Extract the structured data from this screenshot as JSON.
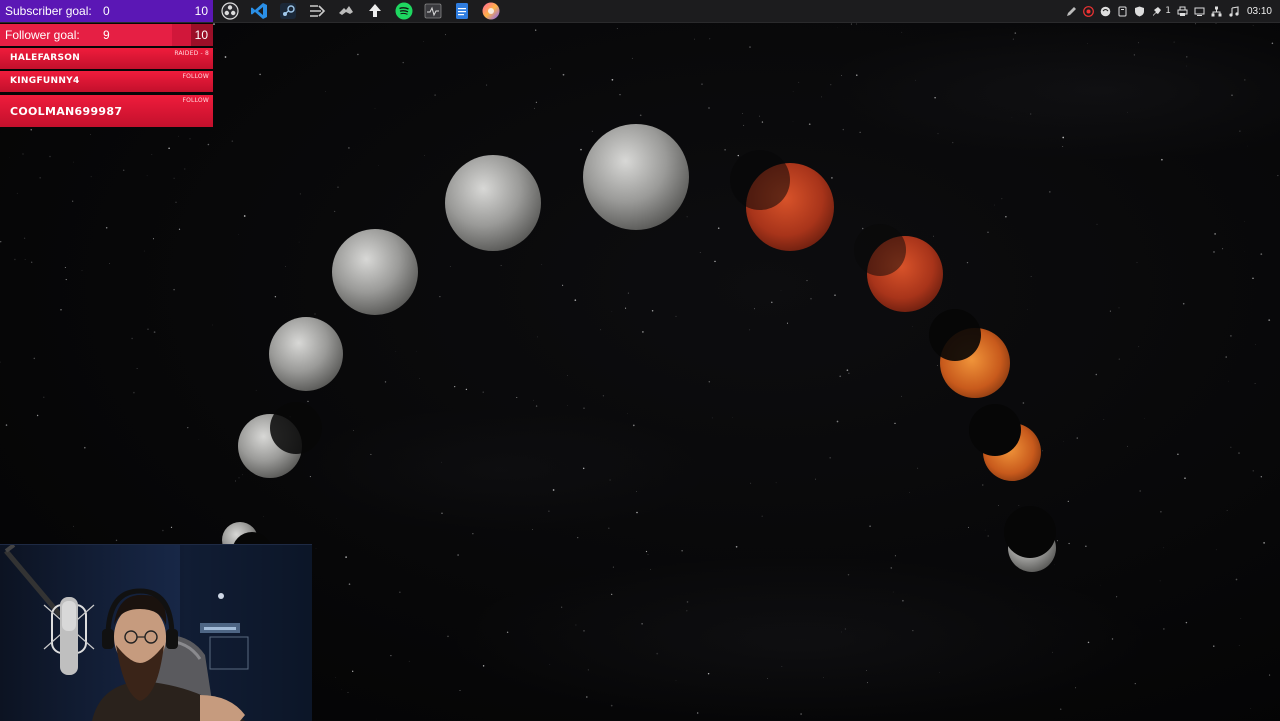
{
  "overlay": {
    "subscriber_goal": {
      "label": "Subscriber goal:",
      "current": "0",
      "target": "10",
      "color": "#5b17b5"
    },
    "follower_goal": {
      "label": "Follower goal:",
      "current": "9",
      "target": "10",
      "progress": 0.9,
      "color": "#e61f44"
    },
    "alerts": [
      {
        "name": "HALEFARSON",
        "type": "RAIDED - 8"
      },
      {
        "name": "KINGFUNNY4",
        "type": "FOLLOW"
      },
      {
        "name": "COOLMAN699987",
        "type": "FOLLOW"
      }
    ]
  },
  "taskbar": {
    "apps": [
      {
        "icon": "obs-icon"
      },
      {
        "icon": "vscode-icon"
      },
      {
        "icon": "steam-icon"
      },
      {
        "icon": "stream-deck-icon"
      },
      {
        "icon": "game-icon"
      },
      {
        "icon": "upload-icon"
      },
      {
        "icon": "spotify-icon"
      },
      {
        "icon": "system-monitor-icon"
      },
      {
        "icon": "files-icon"
      },
      {
        "icon": "color-picker-icon"
      }
    ]
  },
  "tray": {
    "notification_count": "1",
    "clock": "03:10"
  },
  "wallpaper": {
    "subject": "lunar-eclipse-phases"
  }
}
